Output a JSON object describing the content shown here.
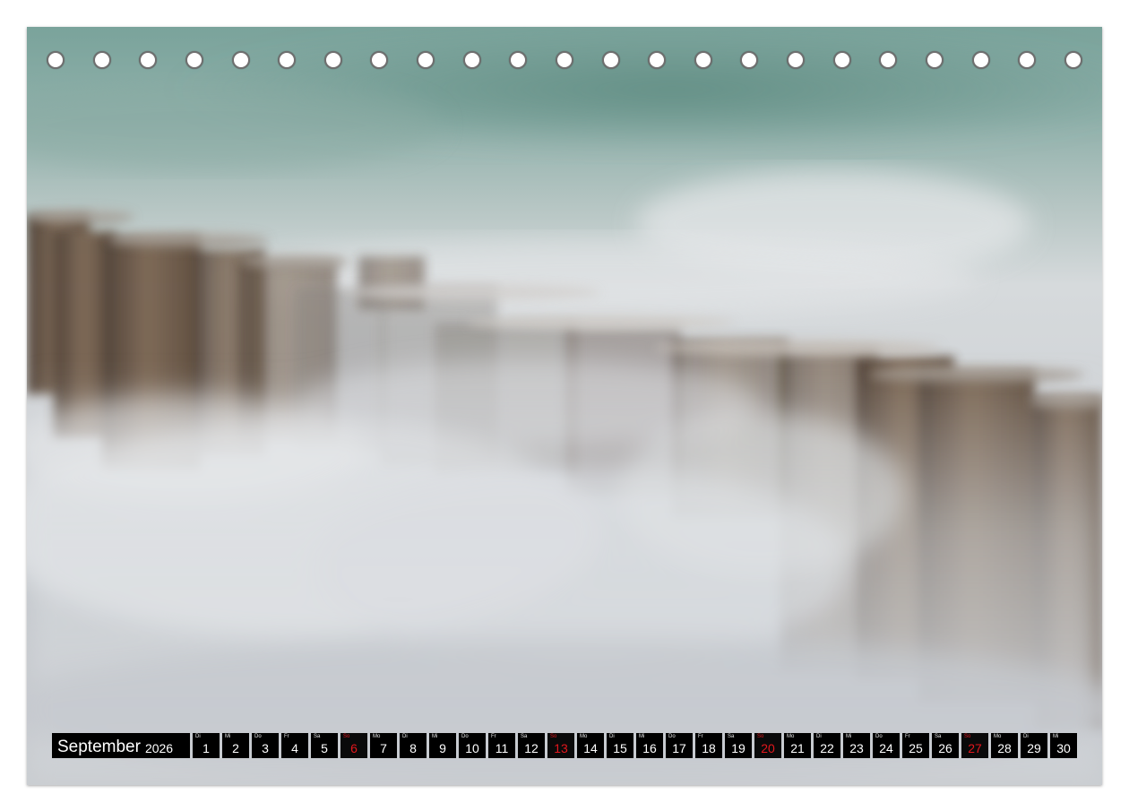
{
  "calendar": {
    "month": "September",
    "year": "2026",
    "days": [
      {
        "wd": "Di",
        "num": "1",
        "sunday": false
      },
      {
        "wd": "Mi",
        "num": "2",
        "sunday": false
      },
      {
        "wd": "Do",
        "num": "3",
        "sunday": false
      },
      {
        "wd": "Fr",
        "num": "4",
        "sunday": false
      },
      {
        "wd": "Sa",
        "num": "5",
        "sunday": false
      },
      {
        "wd": "So",
        "num": "6",
        "sunday": true
      },
      {
        "wd": "Mo",
        "num": "7",
        "sunday": false
      },
      {
        "wd": "Di",
        "num": "8",
        "sunday": false
      },
      {
        "wd": "Mi",
        "num": "9",
        "sunday": false
      },
      {
        "wd": "Do",
        "num": "10",
        "sunday": false
      },
      {
        "wd": "Fr",
        "num": "11",
        "sunday": false
      },
      {
        "wd": "Sa",
        "num": "12",
        "sunday": false
      },
      {
        "wd": "So",
        "num": "13",
        "sunday": true
      },
      {
        "wd": "Mo",
        "num": "14",
        "sunday": false
      },
      {
        "wd": "Di",
        "num": "15",
        "sunday": false
      },
      {
        "wd": "Mi",
        "num": "16",
        "sunday": false
      },
      {
        "wd": "Do",
        "num": "17",
        "sunday": false
      },
      {
        "wd": "Fr",
        "num": "18",
        "sunday": false
      },
      {
        "wd": "Sa",
        "num": "19",
        "sunday": false
      },
      {
        "wd": "So",
        "num": "20",
        "sunday": true
      },
      {
        "wd": "Mo",
        "num": "21",
        "sunday": false
      },
      {
        "wd": "Di",
        "num": "22",
        "sunday": false
      },
      {
        "wd": "Mi",
        "num": "23",
        "sunday": false
      },
      {
        "wd": "Do",
        "num": "24",
        "sunday": false
      },
      {
        "wd": "Fr",
        "num": "25",
        "sunday": false
      },
      {
        "wd": "Sa",
        "num": "26",
        "sunday": false
      },
      {
        "wd": "So",
        "num": "27",
        "sunday": true
      },
      {
        "wd": "Mo",
        "num": "28",
        "sunday": false
      },
      {
        "wd": "Di",
        "num": "29",
        "sunday": false
      },
      {
        "wd": "Mi",
        "num": "30",
        "sunday": false
      }
    ]
  },
  "binding_holes": 23,
  "colors": {
    "sunday": "#e3171d",
    "day_box": "#000000",
    "sea": "#7aa39b",
    "mist": "#d6dadc",
    "groyne_wood": "#6e5a48"
  },
  "photo": {
    "subject_icon": "groyne-posts-in-sea-mist"
  }
}
